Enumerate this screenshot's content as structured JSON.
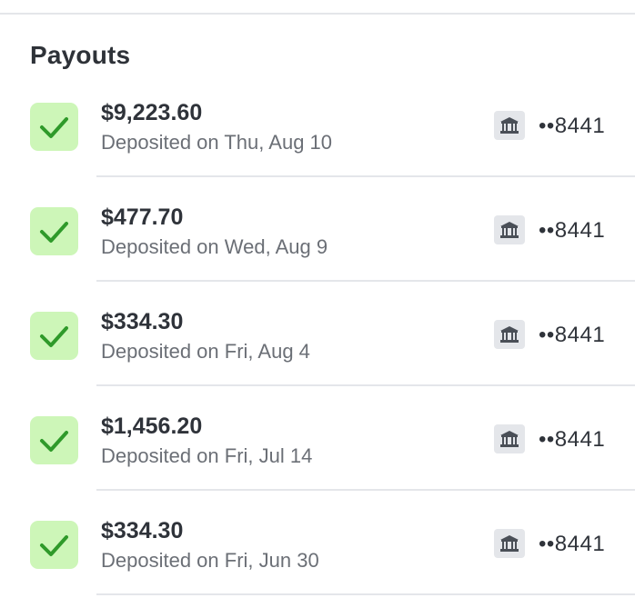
{
  "section": {
    "title": "Payouts"
  },
  "payouts": [
    {
      "amount": "$9,223.60",
      "date": "Deposited on Thu, Aug 10",
      "account": "••8441",
      "icon": "bank-icon",
      "status_icon": "check-icon"
    },
    {
      "amount": "$477.70",
      "date": "Deposited on Wed, Aug 9",
      "account": "••8441",
      "icon": "bank-icon",
      "status_icon": "check-icon"
    },
    {
      "amount": "$334.30",
      "date": "Deposited on Fri, Aug 4",
      "account": "••8441",
      "icon": "bank-icon",
      "status_icon": "check-icon"
    },
    {
      "amount": "$1,456.20",
      "date": "Deposited on Fri, Jul 14",
      "account": "••8441",
      "icon": "bank-icon",
      "status_icon": "check-icon"
    },
    {
      "amount": "$334.30",
      "date": "Deposited on Fri, Jun 30",
      "account": "••8441",
      "icon": "bank-icon",
      "status_icon": "check-icon"
    }
  ],
  "colors": {
    "success_bg": "#cdf6b8",
    "success_check": "#2f9a2a",
    "bank_icon_bg": "#e4e6ea",
    "bank_icon_fg": "#4a4f57",
    "divider": "#e4e6ea"
  }
}
